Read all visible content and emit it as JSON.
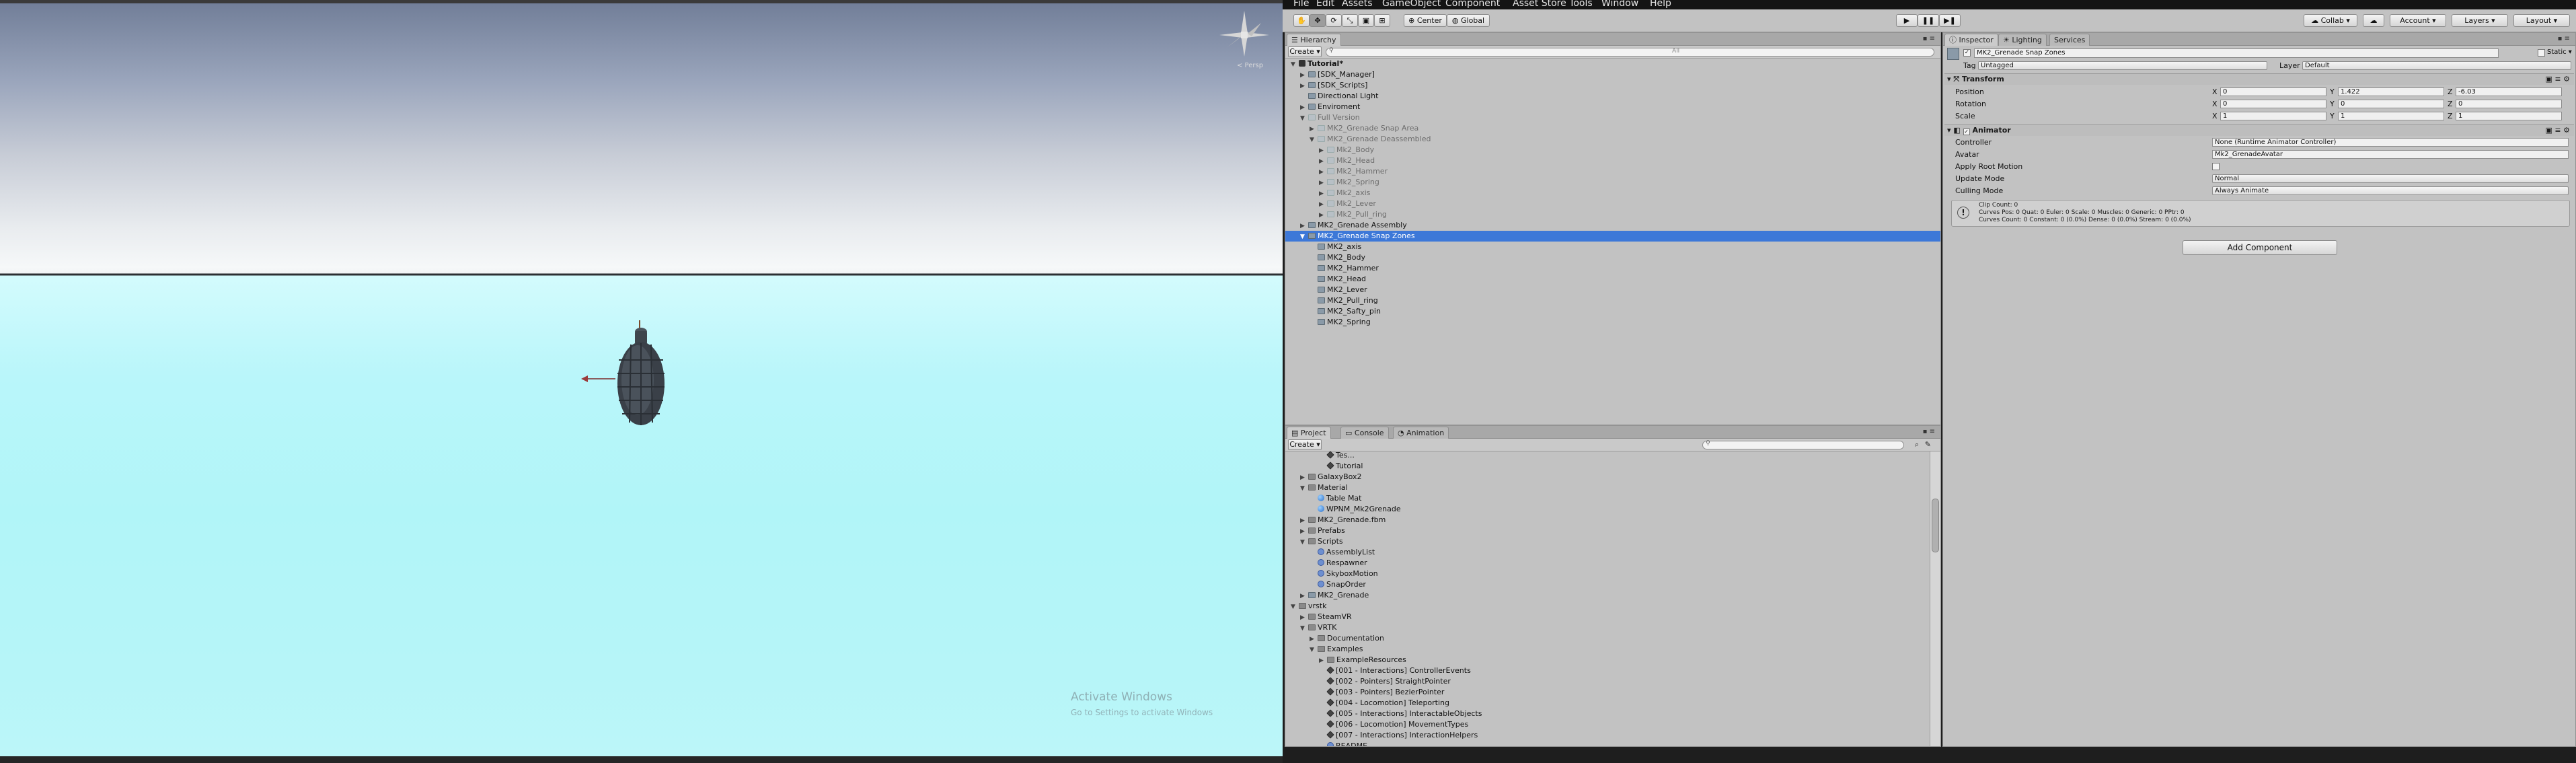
{
  "menu": [
    "File",
    "Edit",
    "Assets",
    "GameObject",
    "Component",
    "Asset Store Tools",
    "Window",
    "Help"
  ],
  "toolbar": {
    "pivot_label": "Center",
    "space_label": "Global",
    "collab_label": "Collab ▾",
    "account_label": "Account",
    "layers_label": "Layers",
    "layout_label": "Layout"
  },
  "scene": {
    "watermark_title": "Activate Windows",
    "watermark_sub": "Go to Settings to activate Windows",
    "persp_label": "< Persp"
  },
  "hierarchy": {
    "tab": "Hierarchy",
    "create_label": "Create ▾",
    "search_placeholder": "All",
    "rows": [
      {
        "label": "Tutorial*",
        "indent": 0,
        "arrow": "▼",
        "icon": "unity",
        "bold": true
      },
      {
        "label": "[SDK_Manager]",
        "indent": 1,
        "arrow": "▶",
        "icon": "go"
      },
      {
        "label": "[SDK_Scripts]",
        "indent": 1,
        "arrow": "▶",
        "icon": "go"
      },
      {
        "label": "Directional Light",
        "indent": 1,
        "arrow": "",
        "icon": "go"
      },
      {
        "label": "Enviroment",
        "indent": 1,
        "arrow": "▶",
        "icon": "go"
      },
      {
        "label": "Full Version",
        "indent": 1,
        "arrow": "▼",
        "icon": "go",
        "dim": true
      },
      {
        "label": "MK2_Grenade Snap Area",
        "indent": 2,
        "arrow": "▶",
        "icon": "go",
        "dim": true
      },
      {
        "label": "MK2_Grenade Deassembled",
        "indent": 2,
        "arrow": "▼",
        "icon": "go",
        "dim": true
      },
      {
        "label": "Mk2_Body",
        "indent": 3,
        "arrow": "▶",
        "icon": "go",
        "dim": true
      },
      {
        "label": "Mk2_Head",
        "indent": 3,
        "arrow": "▶",
        "icon": "go",
        "dim": true
      },
      {
        "label": "Mk2_Hammer",
        "indent": 3,
        "arrow": "▶",
        "icon": "go",
        "dim": true
      },
      {
        "label": "Mk2_Spring",
        "indent": 3,
        "arrow": "▶",
        "icon": "go",
        "dim": true
      },
      {
        "label": "Mk2_axis",
        "indent": 3,
        "arrow": "▶",
        "icon": "go",
        "dim": true
      },
      {
        "label": "Mk2_Lever",
        "indent": 3,
        "arrow": "▶",
        "icon": "go",
        "dim": true
      },
      {
        "label": "Mk2_Pull_ring",
        "indent": 3,
        "arrow": "▶",
        "icon": "go",
        "dim": true
      },
      {
        "label": "MK2_Grenade Assembly",
        "indent": 1,
        "arrow": "▶",
        "icon": "go"
      },
      {
        "label": "MK2_Grenade Snap Zones",
        "indent": 1,
        "arrow": "▼",
        "icon": "go",
        "selected": true
      },
      {
        "label": "MK2_axis",
        "indent": 2,
        "arrow": "",
        "icon": "go"
      },
      {
        "label": "MK2_Body",
        "indent": 2,
        "arrow": "",
        "icon": "go"
      },
      {
        "label": "MK2_Hammer",
        "indent": 2,
        "arrow": "",
        "icon": "go"
      },
      {
        "label": "MK2_Head",
        "indent": 2,
        "arrow": "",
        "icon": "go"
      },
      {
        "label": "MK2_Lever",
        "indent": 2,
        "arrow": "",
        "icon": "go"
      },
      {
        "label": "MK2_Pull_ring",
        "indent": 2,
        "arrow": "",
        "icon": "go"
      },
      {
        "label": "MK2_Safty_pin",
        "indent": 2,
        "arrow": "",
        "icon": "go"
      },
      {
        "label": "MK2_Spring",
        "indent": 2,
        "arrow": "",
        "icon": "go"
      }
    ]
  },
  "project": {
    "tabs": [
      "Project",
      "Console",
      "Animation"
    ],
    "create_label": "Create ▾",
    "rows": [
      {
        "label": "Tes...",
        "indent": 3,
        "arrow": "",
        "icon": "scene"
      },
      {
        "label": "Tutorial",
        "indent": 3,
        "arrow": "",
        "icon": "scene"
      },
      {
        "label": "GalaxyBox2",
        "indent": 1,
        "arrow": "▶",
        "icon": "folder"
      },
      {
        "label": "Material",
        "indent": 1,
        "arrow": "▼",
        "icon": "folder"
      },
      {
        "label": "Table Mat",
        "indent": 2,
        "arrow": "",
        "icon": "mat"
      },
      {
        "label": "WPNM_Mk2Grenade",
        "indent": 2,
        "arrow": "",
        "icon": "mat"
      },
      {
        "label": "MK2_Grenade.fbm",
        "indent": 1,
        "arrow": "▶",
        "icon": "folder"
      },
      {
        "label": "Prefabs",
        "indent": 1,
        "arrow": "▶",
        "icon": "folder"
      },
      {
        "label": "Scripts",
        "indent": 1,
        "arrow": "▼",
        "icon": "folder"
      },
      {
        "label": "AssemblyList",
        "indent": 2,
        "arrow": "",
        "icon": "script"
      },
      {
        "label": "Respawner",
        "indent": 2,
        "arrow": "",
        "icon": "script"
      },
      {
        "label": "SkyboxMotion",
        "indent": 2,
        "arrow": "",
        "icon": "script"
      },
      {
        "label": "SnapOrder",
        "indent": 2,
        "arrow": "",
        "icon": "script"
      },
      {
        "label": "MK2_Grenade",
        "indent": 1,
        "arrow": "▶",
        "icon": "go"
      },
      {
        "label": "vrstk",
        "indent": 0,
        "arrow": "▼",
        "icon": "folder"
      },
      {
        "label": "SteamVR",
        "indent": 1,
        "arrow": "▶",
        "icon": "folder"
      },
      {
        "label": "VRTK",
        "indent": 1,
        "arrow": "▼",
        "icon": "folder"
      },
      {
        "label": "Documentation",
        "indent": 2,
        "arrow": "▶",
        "icon": "folder"
      },
      {
        "label": "Examples",
        "indent": 2,
        "arrow": "▼",
        "icon": "folder"
      },
      {
        "label": "ExampleResources",
        "indent": 3,
        "arrow": "▶",
        "icon": "folder"
      },
      {
        "label": "[001 - Interactions] ControllerEvents",
        "indent": 3,
        "arrow": "",
        "icon": "scene"
      },
      {
        "label": "[002 - Pointers] StraightPointer",
        "indent": 3,
        "arrow": "",
        "icon": "scene"
      },
      {
        "label": "[003 - Pointers] BezierPointer",
        "indent": 3,
        "arrow": "",
        "icon": "scene"
      },
      {
        "label": "[004 - Locomotion] Teleporting",
        "indent": 3,
        "arrow": "",
        "icon": "scene"
      },
      {
        "label": "[005 - Interactions] InteractableObjects",
        "indent": 3,
        "arrow": "",
        "icon": "scene"
      },
      {
        "label": "[006 - Locomotion] MovementTypes",
        "indent": 3,
        "arrow": "",
        "icon": "scene"
      },
      {
        "label": "[007 - Interactions] InteractionHelpers",
        "indent": 3,
        "arrow": "",
        "icon": "scene"
      },
      {
        "label": "README",
        "indent": 3,
        "arrow": "",
        "icon": "script"
      }
    ]
  },
  "inspector": {
    "tabs": [
      "Inspector",
      "Lighting",
      "Services"
    ],
    "object_name": "MK2_Grenade Snap Zones",
    "static_label": "Static ▾",
    "tag_label": "Tag",
    "tag_value": "Untagged",
    "layer_label": "Layer",
    "layer_value": "Default",
    "transform": {
      "title": "Transform",
      "position_label": "Position",
      "rotation_label": "Rotation",
      "scale_label": "Scale",
      "position": {
        "x": "0",
        "y": "1.422",
        "z": "-6.03"
      },
      "rotation": {
        "x": "0",
        "y": "0",
        "z": "0"
      },
      "scale": {
        "x": "1",
        "y": "1",
        "z": "1"
      }
    },
    "animator": {
      "title": "Animator",
      "controller_label": "Controller",
      "controller_value": "None (Runtime Animator Controller)",
      "avatar_label": "Avatar",
      "avatar_value": "Mk2_GrenadeAvatar",
      "apply_root_label": "Apply Root Motion",
      "update_mode_label": "Update Mode",
      "update_mode_value": "Normal",
      "culling_mode_label": "Culling Mode",
      "culling_mode_value": "Always Animate",
      "info_line1": "Clip Count: 0",
      "info_line2": "Curves Pos: 0 Quat: 0 Euler: 0 Scale: 0 Muscles: 0 Generic: 0 PPtr: 0",
      "info_line3": "Curves Count: 0 Constant: 0 (0.0%) Dense: 0 (0.0%) Stream: 0 (0.0%)"
    },
    "add_component_label": "Add Component"
  },
  "axis_labels": {
    "x": "X",
    "y": "Y",
    "z": "Z"
  },
  "colors": {
    "selection": "#3d78d8",
    "panel": "#c2c2c2"
  }
}
